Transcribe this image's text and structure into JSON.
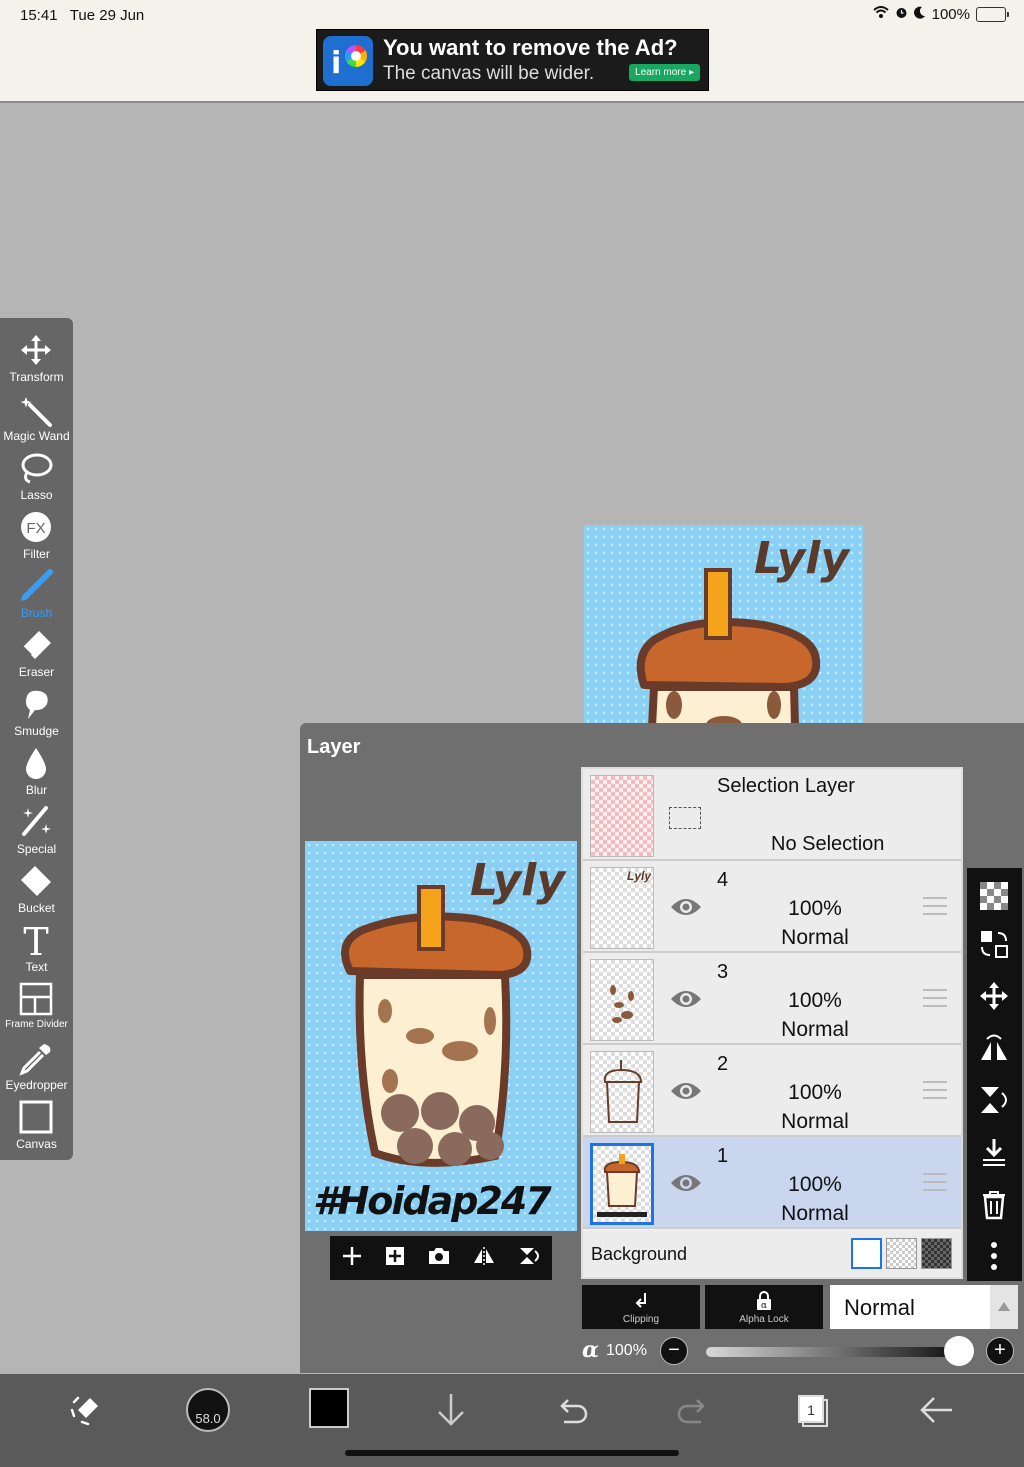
{
  "status": {
    "time": "15:41",
    "date": "Tue 29 Jun",
    "battery": "100%"
  },
  "ad": {
    "title": "You want to remove the Ad?",
    "subtitle": "The canvas will be wider.",
    "button": "Learn more"
  },
  "tools": [
    {
      "label": "Transform",
      "icon": "move-arrows-icon"
    },
    {
      "label": "Magic Wand",
      "icon": "magic-wand-icon"
    },
    {
      "label": "Lasso",
      "icon": "lasso-icon"
    },
    {
      "label": "Filter",
      "icon": "fx-icon"
    },
    {
      "label": "Brush",
      "icon": "brush-icon",
      "active": true
    },
    {
      "label": "Eraser",
      "icon": "eraser-icon"
    },
    {
      "label": "Smudge",
      "icon": "smudge-icon"
    },
    {
      "label": "Blur",
      "icon": "drop-icon"
    },
    {
      "label": "Special",
      "icon": "sparkle-icon"
    },
    {
      "label": "Bucket",
      "icon": "bucket-icon"
    },
    {
      "label": "Text",
      "icon": "text-icon"
    },
    {
      "label": "Frame Divider",
      "icon": "frame-divider-icon"
    },
    {
      "label": "Eyedropper",
      "icon": "eyedropper-icon"
    },
    {
      "label": "Canvas",
      "icon": "canvas-icon"
    }
  ],
  "artwork": {
    "signature": "Lyly",
    "hashtag": "#Hoidap247"
  },
  "layer_panel": {
    "title": "Layer",
    "selection_layer": {
      "name": "Selection Layer",
      "status": "No Selection"
    },
    "layers": [
      {
        "num": "4",
        "opacity": "100%",
        "mode": "Normal",
        "selected": false
      },
      {
        "num": "3",
        "opacity": "100%",
        "mode": "Normal",
        "selected": false
      },
      {
        "num": "2",
        "opacity": "100%",
        "mode": "Normal",
        "selected": false
      },
      {
        "num": "1",
        "opacity": "100%",
        "mode": "Normal",
        "selected": true
      }
    ],
    "background_label": "Background",
    "clipping_label": "Clipping",
    "alpha_lock_label": "Alpha Lock",
    "blend_mode": "Normal",
    "alpha_value": "100%",
    "alpha_fraction": 1.0
  },
  "bottom_bar": {
    "brush_size": "58.0"
  },
  "colors": {
    "canvas_blue": "#8ad0f5",
    "cup_brown": "#c8672c",
    "straw_orange": "#f5a31a",
    "outline": "#6b3b2a",
    "accent_blue": "#3a9cf5"
  }
}
